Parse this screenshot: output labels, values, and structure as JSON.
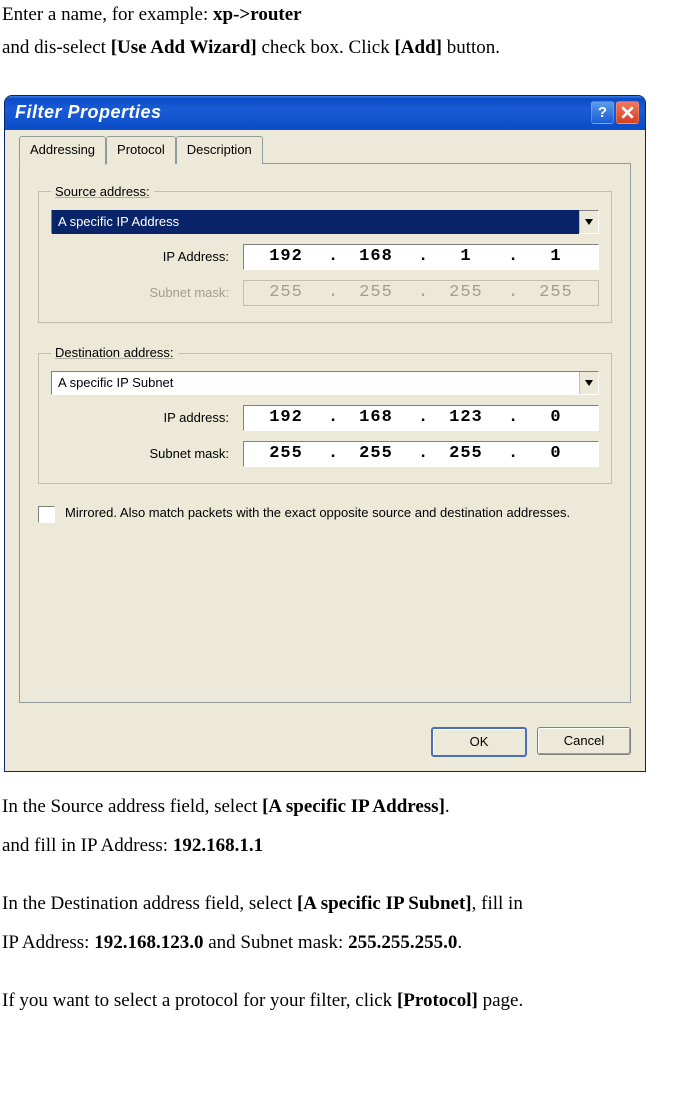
{
  "intro": {
    "line1_a": "Enter a name, for example: ",
    "line1_b": "xp->router",
    "line2_a": "and dis-select ",
    "line2_b": "[Use Add Wizard]",
    "line2_c": " check box. Click ",
    "line2_d": "[Add]",
    "line2_e": " button."
  },
  "dialog": {
    "title": "Filter Properties",
    "tabs": {
      "addressing": "Addressing",
      "protocol": "Protocol",
      "description": "Description"
    },
    "source": {
      "legend": "Source address:",
      "type": "A specific IP Address",
      "ip_label": "IP Address:",
      "ip": [
        "192",
        "168",
        "1",
        "1"
      ],
      "mask_label": "Subnet mask:",
      "mask": [
        "255",
        "255",
        "255",
        "255"
      ]
    },
    "dest": {
      "legend": "Destination address:",
      "type": "A specific IP Subnet",
      "ip_label": "IP address:",
      "ip": [
        "192",
        "168",
        "123",
        "0"
      ],
      "mask_label": "Subnet mask:",
      "mask": [
        "255",
        "255",
        "255",
        "0"
      ]
    },
    "mirrored_label": "Mirrored. Also match packets with the exact opposite source and destination addresses.",
    "buttons": {
      "ok": "OK",
      "cancel": "Cancel"
    }
  },
  "post": {
    "p1_a": "In the Source address field, select ",
    "p1_b": "[A specific IP Address]",
    "p1_c": ".",
    "p2_a": "and fill in IP Address: ",
    "p2_b": "192.168.1.1",
    "p3_a": "In the Destination address field, select ",
    "p3_b": "[A specific IP Subnet]",
    "p3_c": ", fill in",
    "p4_a": "IP Address: ",
    "p4_b": "192.168.123.0",
    "p4_c": " and Subnet mask: ",
    "p4_d": "255.255.255.0",
    "p4_e": ".",
    "p5_a": "If you want to select a protocol for your filter, click ",
    "p5_b": "[Protocol]",
    "p5_c": " page."
  }
}
